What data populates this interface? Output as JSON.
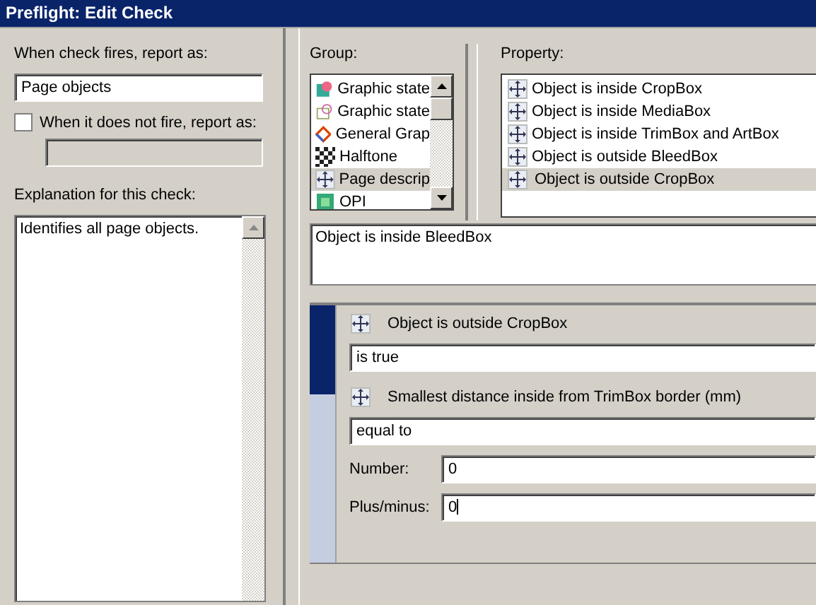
{
  "window": {
    "title": "Preflight: Edit Check"
  },
  "report": {
    "label": "When check fires, report as:",
    "value": "Page objects"
  },
  "not_fire": {
    "label": "When it does not fire, report as:",
    "checked": false,
    "disabled": true
  },
  "explanation": {
    "label": "Explanation for this check:",
    "value": "Identifies all page objects."
  },
  "group": {
    "label": "Group:",
    "items": [
      {
        "label": "Graphic state",
        "kind": "palette",
        "selected": false
      },
      {
        "label": "Graphic state",
        "kind": "outline",
        "selected": false
      },
      {
        "label": "General Grap",
        "kind": "diamond",
        "selected": false
      },
      {
        "label": "Halftone",
        "kind": "dots",
        "selected": false
      },
      {
        "label": "Page descrip",
        "kind": "arrows",
        "selected": true
      },
      {
        "label": "OPI",
        "kind": "square",
        "selected": false
      }
    ]
  },
  "property": {
    "label": "Property:",
    "items": [
      {
        "label": "Object is inside CropBox",
        "selected": false
      },
      {
        "label": "Object is inside MediaBox",
        "selected": false
      },
      {
        "label": "Object is inside TrimBox and ArtBox",
        "selected": false
      },
      {
        "label": "Object is outside BleedBox",
        "selected": false
      },
      {
        "label": "Object is outside CropBox",
        "selected": true
      }
    ]
  },
  "description": "Object is inside BleedBox",
  "conditions": [
    {
      "label": "Object is outside CropBox",
      "operator": "is true",
      "selected": true
    },
    {
      "label": "Smallest distance inside from TrimBox border (mm)",
      "operator": "equal to",
      "selected": false,
      "number_label": "Number:",
      "number": "0",
      "tolerance_label": "Plus/minus:",
      "tolerance": "0"
    }
  ]
}
